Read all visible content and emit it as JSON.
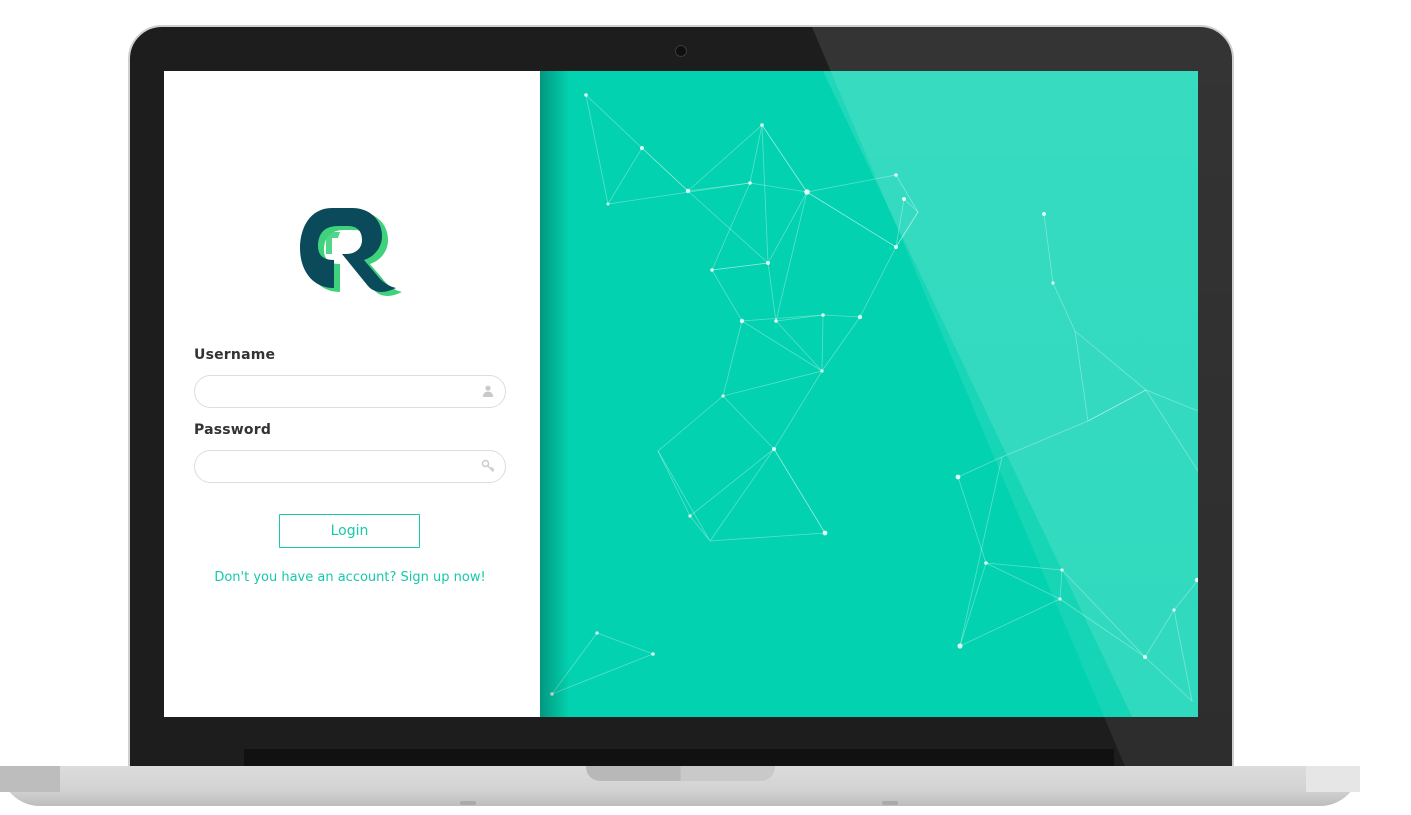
{
  "login_form": {
    "username_label": "Username",
    "username_value": "",
    "password_label": "Password",
    "password_value": "",
    "login_button": "Login",
    "signup_text": "Don't you have an account? Sign up now!"
  },
  "colors": {
    "accent": "#17c9a9",
    "background_panel": "#02d2b0",
    "logo_dark": "#0b4a5a",
    "logo_green": "#3fd27c"
  },
  "icons": {
    "username_field": "user-icon",
    "password_field": "key-icon"
  }
}
